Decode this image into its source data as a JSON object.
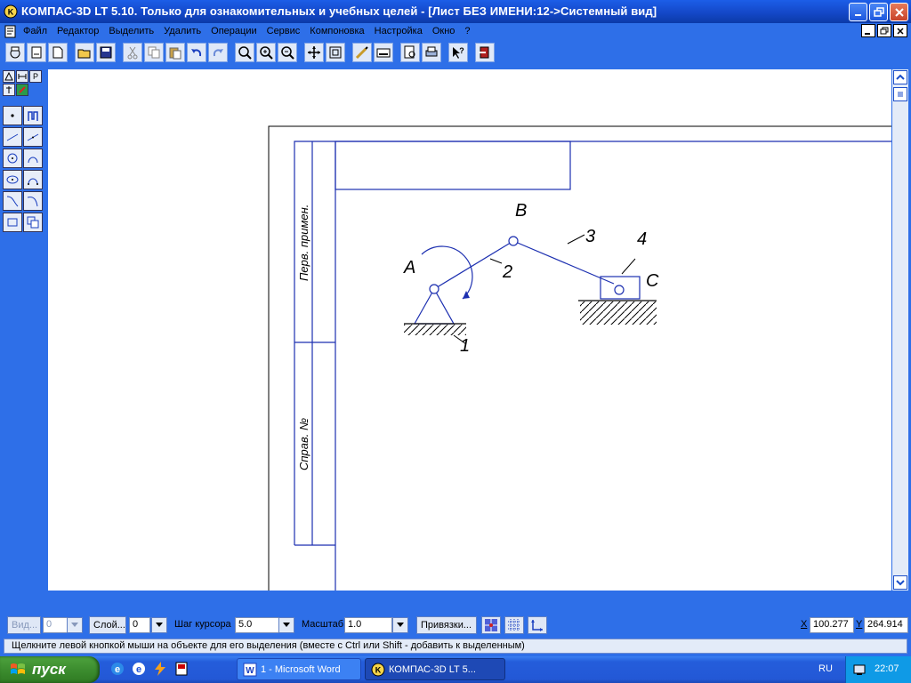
{
  "window": {
    "title": "КОМПАС-3D LT 5.10. Только для ознакомительных и учебных целей - [Лист БЕЗ ИМЕНИ:12->Системный вид]",
    "buttons": [
      "minimize-icon",
      "restore-icon",
      "close-icon"
    ]
  },
  "menu": {
    "items": [
      "Файл",
      "Редактор",
      "Выделить",
      "Удалить",
      "Операции",
      "Сервис",
      "Компоновка",
      "Настройка",
      "Окно",
      "?"
    ]
  },
  "toolbar": {
    "icons": [
      "new-drawing-icon",
      "new-sheet-icon",
      "new-document-icon",
      "open-icon",
      "save-icon",
      "cut-icon",
      "copy-icon",
      "paste-icon",
      "undo-icon",
      "redo-icon",
      "zoom-window-icon",
      "zoom-in-icon",
      "zoom-out-icon",
      "pan-icon",
      "zoom-all-icon",
      "properties-icon",
      "tools-icon",
      "print-preview-icon",
      "print-icon",
      "help-context-icon",
      "exit-icon"
    ]
  },
  "left_panel": {
    "tabs": [
      "geometry-tab-icon",
      "dimensions-tab-icon",
      "P",
      "measure-tab-icon",
      "edit-tab-icon"
    ],
    "tools": [
      "point-icon",
      "auxiliary-curve-icon",
      "segment-icon",
      "parallel-segment-icon",
      "circle-icon",
      "arc-icon",
      "ellipse-icon",
      "arc-three-points-icon",
      "bezier-curve-icon",
      "spline-icon",
      "rectangle-icon",
      "hatch-icon"
    ]
  },
  "drawing": {
    "stamp_top": "Перв. примен.",
    "stamp_bottom": "Справ. №",
    "labels": {
      "A": "A",
      "B": "B",
      "C": "C",
      "n1": "1",
      "n2": "2",
      "n3": "3",
      "n4": "4"
    },
    "line_color": "#1c2fb0"
  },
  "status": {
    "view_label": "Вид...",
    "view_value": "0",
    "layer_label": "Слой...",
    "layer_value": "0",
    "step_label": "Шаг курсора",
    "step_value": "5.0",
    "scale_label": "Масштаб",
    "scale_value": "1.0",
    "snap_label": "Привязки...",
    "x_label": "X",
    "x_value": "100.277",
    "y_label": "Y",
    "y_value": "264.914",
    "hint": "Щелкните левой кнопкой мыши на объекте для его выделения (вместе с Ctrl или Shift - добавить к выделенным)"
  },
  "taskbar": {
    "start_label": "пуск",
    "quick_launch": [
      "ie-icon",
      "outlook-icon",
      "winamp-icon",
      "media-icon"
    ],
    "tasks": [
      {
        "label": "1 - Microsoft Word",
        "active": false
      },
      {
        "label": "КОМПАС-3D LT 5...",
        "active": true
      }
    ],
    "language": "RU",
    "clock": "22:07"
  }
}
